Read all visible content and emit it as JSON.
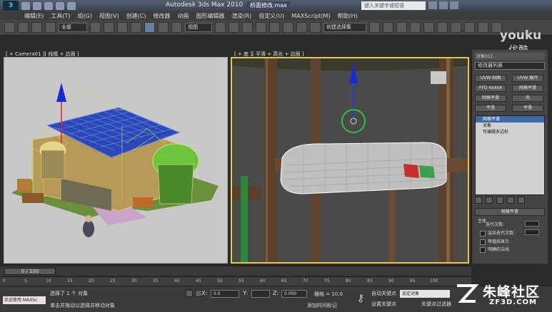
{
  "titlebar": {
    "app_name": "Autodesk 3ds Max 2010",
    "file_name": "桥面修改.max",
    "search_placeholder": "键入关键字或短语"
  },
  "menu": [
    "编辑(E)",
    "工具(T)",
    "组(G)",
    "视图(V)",
    "创建(C)",
    "修改器",
    "动画",
    "图形编辑器",
    "渲染(R)",
    "自定义(U)",
    "MAXScript(M)",
    "帮助(H)"
  ],
  "toolbar": {
    "filter_select": "全部",
    "coord_select": "视图",
    "selection_set": "创建选择集"
  },
  "watermark": {
    "youku": "youku",
    "youku_sub": "优酷",
    "site": "朱峰社区",
    "site_sub": "ZF3D.COM"
  },
  "viewports": {
    "left_label": "[ + Camera01 ][ 线框 + 边面 ]",
    "right_label": "[ + 底 ][ 平滑 + 高光 + 边面 ]"
  },
  "command_panel": {
    "object_name": "对象011",
    "modifier_list": "修改器列表",
    "buttons": [
      "UVW 贴图",
      "UVW 展开",
      "FFD 4x4x4",
      "网格平滑",
      "网格平滑",
      "壳",
      "平滑",
      "平滑"
    ],
    "stack": [
      "网格平滑",
      "对象",
      "可编辑多边形"
    ],
    "rollout_title": "网格平滑",
    "main_section": "主体",
    "iterations_label": "迭代次数:",
    "render_iters_label": "渲染迭代次数:",
    "isoline_display": "等值线显示",
    "explicit_normals": "明确的法线",
    "surface_section": "曲面参数",
    "smooth_result": "平滑结果",
    "separate_by": "分隔方式:",
    "materials": "材质",
    "smoothing_groups": "平滑组",
    "update_section": "更新选项",
    "always": "始终"
  },
  "timeline": {
    "slider": "0 / 100",
    "ticks": [
      "0",
      "5",
      "10",
      "15",
      "20",
      "25",
      "30",
      "35",
      "40",
      "45",
      "50",
      "55",
      "60",
      "65",
      "70",
      "75",
      "80",
      "85",
      "90",
      "95",
      "100"
    ]
  },
  "status": {
    "maxscript": "欢迎使用 MAXSc",
    "selected": "选择了 1 个 对象",
    "prompt": "单击并拖动以选择并移动对象",
    "x_label": "X:",
    "y_label": "Y:",
    "z_label": "Z:",
    "x_val": "0.0",
    "y_val": "",
    "z_val": "0.000",
    "grid": "栅格 = 10.0",
    "add_time_tag": "添加时间标记",
    "auto_key": "自动关键点",
    "set_key": "设置关键点",
    "key_select": "选定对象",
    "key_filters": "关键点过滤器"
  }
}
